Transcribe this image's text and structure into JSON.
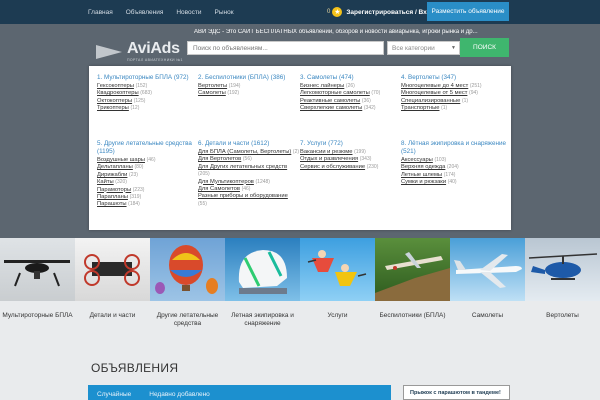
{
  "topnav": {
    "items": [
      "Главная",
      "Объявления",
      "Новости",
      "Рынок"
    ]
  },
  "user": {
    "coins": "0",
    "register_login": "Зарегистрироваться / Вход",
    "post_ad": "Разместить объявление"
  },
  "logo": {
    "name": "AviAds",
    "subtitle": "ПОРТАЛ АВИАТЕХНИКИ №1"
  },
  "tagline": "АВИ ЭДС - Это САЙТ БЕСПЛАТНЫХ объявлений, обзоров и новости авиарынка, игроки рынка и др...",
  "search": {
    "placeholder": "Поиск по объявлениям...",
    "category": "Все категории",
    "button": "ПОИСК"
  },
  "categories": [
    {
      "title": "1. Мультироторные БПЛА (972)",
      "items": [
        {
          "label": "Гексокоптеры",
          "count": "(152)"
        },
        {
          "label": "Квадрокоптеры",
          "count": "(683)"
        },
        {
          "label": "Октокоптеры",
          "count": "(125)"
        },
        {
          "label": "Трикоптеры",
          "count": "(12)"
        }
      ]
    },
    {
      "title": "2. Беспилотники (БПЛА) (386)",
      "items": [
        {
          "label": "Вертолеты",
          "count": "(194)"
        },
        {
          "label": "Самолеты",
          "count": "(192)"
        }
      ]
    },
    {
      "title": "3. Самолеты (474)",
      "items": [
        {
          "label": "Бизнес лайнеры",
          "count": "(26)"
        },
        {
          "label": "Легкомоторные самолеты",
          "count": "(70)"
        },
        {
          "label": "Реактивные самолеты",
          "count": "(36)"
        },
        {
          "label": "Сверхлегкие самолеты",
          "count": "(342)"
        }
      ]
    },
    {
      "title": "4. Вертолеты (347)",
      "items": [
        {
          "label": "Многоцелевые до 4 мест",
          "count": "(251)"
        },
        {
          "label": "Многоцелевые от 5 мест",
          "count": "(94)"
        },
        {
          "label": "Специализированные",
          "count": "(1)"
        },
        {
          "label": "Транспортные",
          "count": "(1)"
        }
      ]
    },
    {
      "title": "5. Другие летательные средства (1195)",
      "items": [
        {
          "label": "Воздушные шары",
          "count": "(46)"
        },
        {
          "label": "Дельтапланы",
          "count": "(80)"
        },
        {
          "label": "Дирижабли",
          "count": "(23)"
        },
        {
          "label": "Кайты",
          "count": "(320)"
        },
        {
          "label": "Парамоторы",
          "count": "(223)"
        },
        {
          "label": "Парапланы",
          "count": "(319)"
        },
        {
          "label": "Парашюты",
          "count": "(184)"
        }
      ]
    },
    {
      "title": "6. Детали и части (1612)",
      "items": [
        {
          "label": "Для БПЛА (Самолеты, Вертолеты)",
          "count": "(2)"
        },
        {
          "label": "Для Вертолетов",
          "count": "(56)"
        },
        {
          "label": "Для Других летательных средств",
          "count": "(205)"
        },
        {
          "label": "Для Мультикоптеров",
          "count": "(1248)"
        },
        {
          "label": "Для Самолетов",
          "count": "(46)"
        },
        {
          "label": "Разные приборы и оборудование",
          "count": "(55)"
        }
      ]
    },
    {
      "title": "7. Услуги (772)",
      "items": [
        {
          "label": "Вакансии и резюме",
          "count": "(199)"
        },
        {
          "label": "Отдых и развлечения",
          "count": "(343)"
        },
        {
          "label": "Сервис и обслуживание",
          "count": "(230)"
        }
      ]
    },
    {
      "title": "8. Лётная экипировка и снаряжение (521)",
      "items": [
        {
          "label": "Аксессуары",
          "count": "(103)"
        },
        {
          "label": "Верхняя одежда",
          "count": "(204)"
        },
        {
          "label": "Летные шлемы",
          "count": "(174)"
        },
        {
          "label": "Сумки и рюкзаки",
          "count": "(40)"
        }
      ]
    }
  ],
  "tiles": [
    "Мультироторные БПЛА",
    "Детали и части",
    "Другие летательные средства",
    "Летная экипировка и снаряжение",
    "Услуги",
    "Беспилотники (БПЛА)",
    "Самолеты",
    "Вертолеты"
  ],
  "main": {
    "heading": "ОБЪЯВЛЕНИЯ",
    "tabs": [
      "Случайные",
      "Недавно добавлено"
    ],
    "ad_caption": "Прыжок с парашютом в тандеме!"
  },
  "colors": {
    "topbar": "#1d3b52",
    "accent": "#2a8ec7",
    "search_button": "#3fb66e",
    "link": "#3a87c1"
  }
}
